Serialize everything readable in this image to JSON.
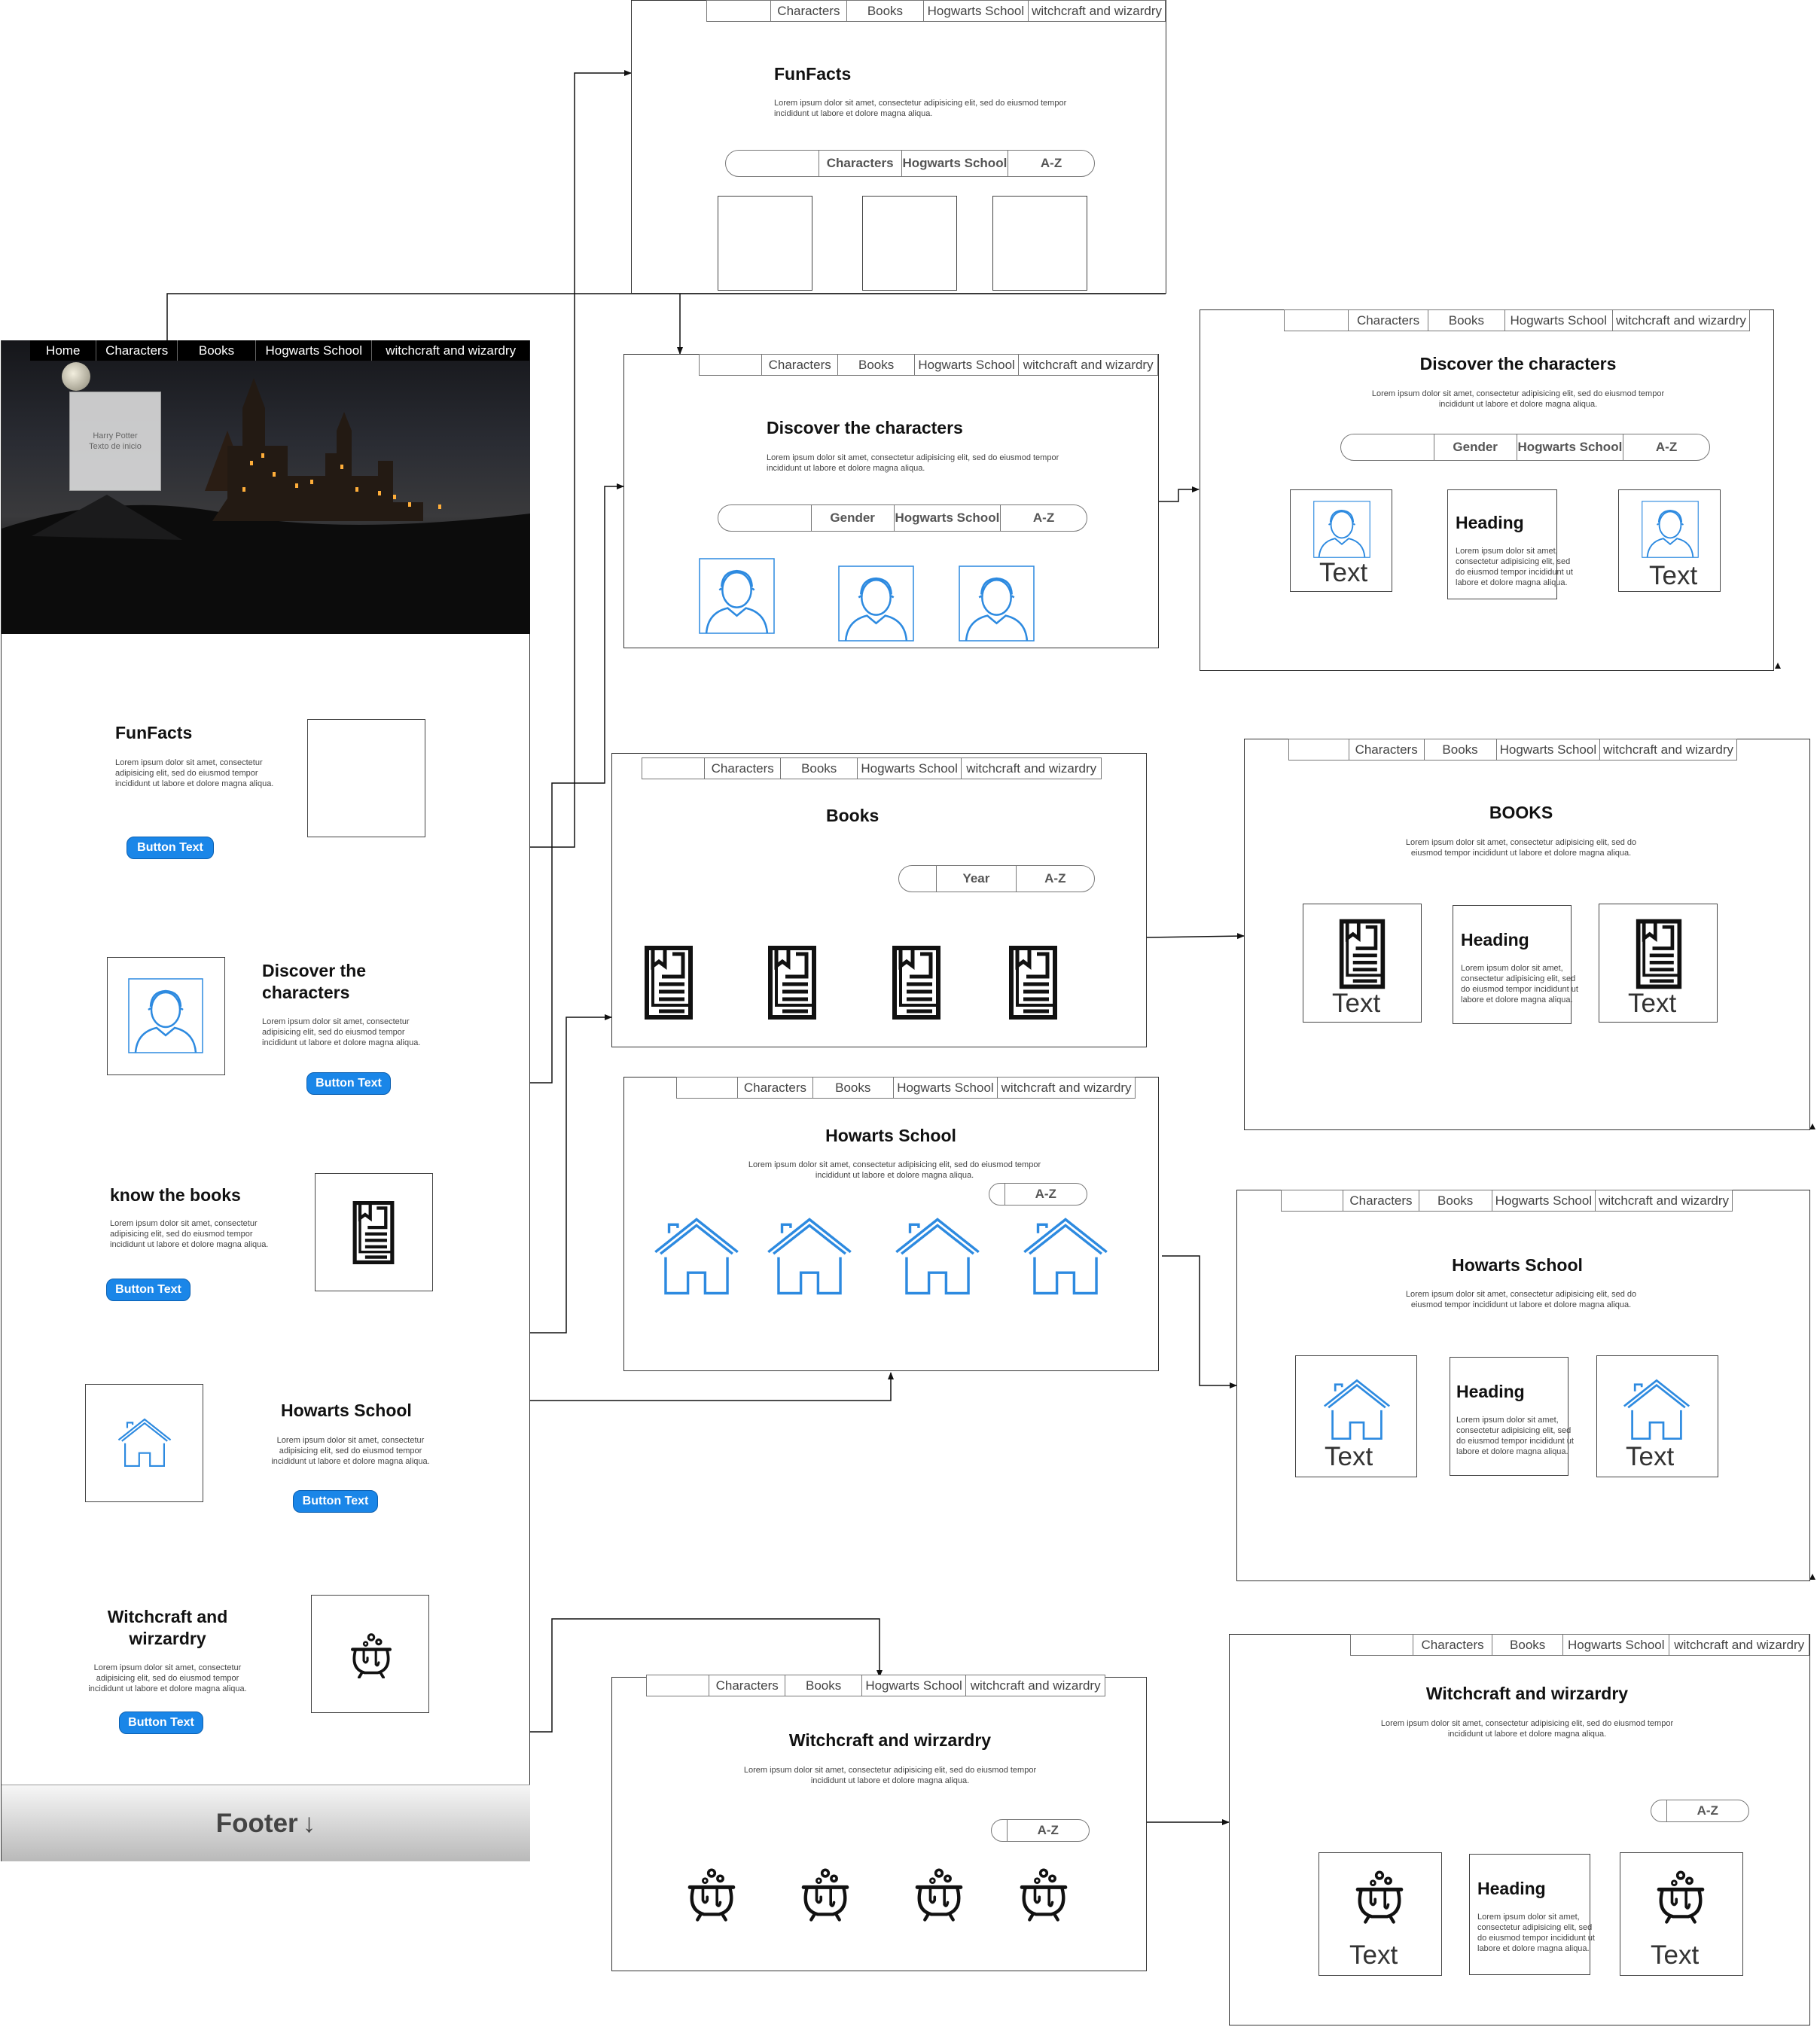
{
  "nav": {
    "home": "Home",
    "characters": "Characters",
    "books": "Books",
    "hogwarts": "Hogwarts School",
    "witchcraft": "witchcraft and wizardry"
  },
  "lorem_short": "Lorem ipsum dolor sit amet, consectetur adipisicing elit, sed do eiusmod tempor incididunt ut labore et dolore magna aliqua.",
  "main_page": {
    "hero_caption_line1": "Harry Potter",
    "hero_caption_line2": "Texto de inicio",
    "funfacts_title": "FunFacts",
    "discover_title": "Discover the characters",
    "books_title": "know the books",
    "hogwarts_title": "Howarts School",
    "witchcraft_title": "Witchcraft and wirzardry",
    "button_text": "Button Text",
    "footer": "Footer"
  },
  "frames": {
    "funfacts_title": "FunFacts",
    "discover_title": "Discover the characters",
    "books_title": "Books",
    "books_detail_title": "BOOKS",
    "hogwarts_title": "Howarts School",
    "witchcraft_title": "Witchcraft and wirzardry"
  },
  "filters": {
    "characters": "Characters",
    "hogwarts": "Hogwarts School",
    "az": "A-Z",
    "gender": "Gender",
    "year": "Year"
  },
  "cards": {
    "text": "Text",
    "heading": "Heading"
  },
  "icons": [
    "avatar-icon",
    "book-icon",
    "house-icon",
    "cauldron-icon",
    "moon-icon"
  ],
  "colors": {
    "accent": "#1a86e8",
    "icon_blue": "#2d8ae0"
  }
}
